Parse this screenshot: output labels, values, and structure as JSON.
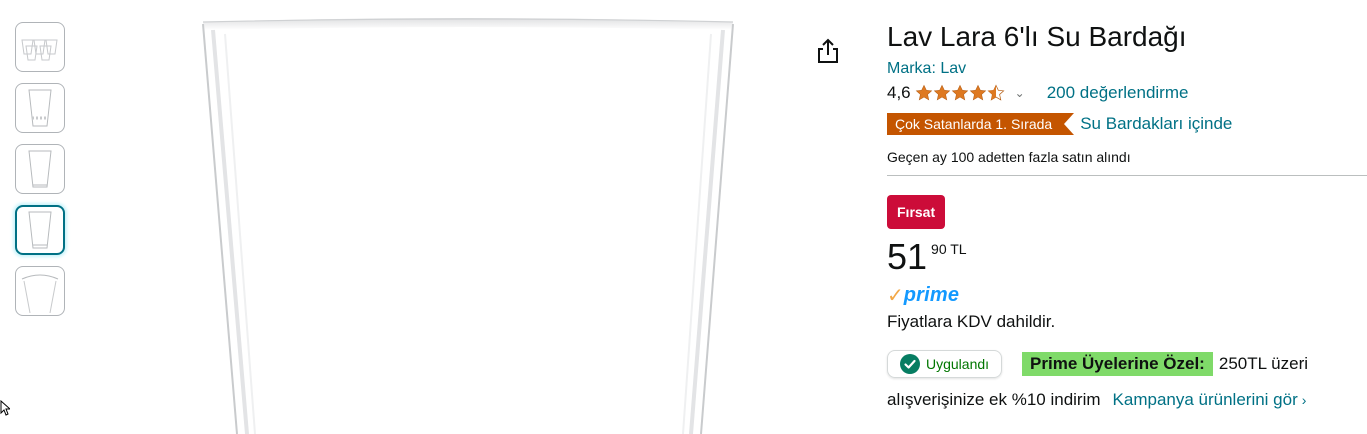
{
  "product": {
    "title": "Lav Lara 6'lı Su Bardağı",
    "brand_label": "Marka: Lav",
    "rating_value": "4,6",
    "rating_stars": 4.6,
    "reviews_label": "200 değerlendirme",
    "bestseller_badge": "Çok Satanlarda 1. Sırada",
    "bestseller_category": "Su Bardakları içinde",
    "bought_text": "Geçen ay 100 adetten fazla satın alındı"
  },
  "deal": {
    "badge_label": "Fırsat"
  },
  "price": {
    "whole": "51",
    "fraction": "90 TL"
  },
  "prime": {
    "check": "✓",
    "word": "prime"
  },
  "vat_text": "Fiyatlara KDV dahildir.",
  "promo": {
    "applied_label": "Uygulandı",
    "prime_only_label": "Prime Üyelerine Özel:",
    "text_line1": "250TL üzeri",
    "text_line2": "alışverişinize ek %10 indirim",
    "link_label": "Kampanya ürünlerini gör",
    "link_arrow": "›"
  },
  "thumbnails": [
    {
      "name": "set-of-glasses"
    },
    {
      "name": "glass-side-pattern"
    },
    {
      "name": "glass-plain"
    },
    {
      "name": "glass-plain-selected",
      "selected": true
    },
    {
      "name": "glass-closeup"
    }
  ],
  "colors": {
    "link": "#007185",
    "bestseller": "#c45500",
    "deal": "#cc0c39",
    "prime_highlight": "#7fda69",
    "applied_green": "#007600",
    "star": "#de7921"
  },
  "icons": [
    "share-icon",
    "star-icon",
    "chevron-down-icon",
    "check-circle-icon",
    "cursor-icon"
  ]
}
